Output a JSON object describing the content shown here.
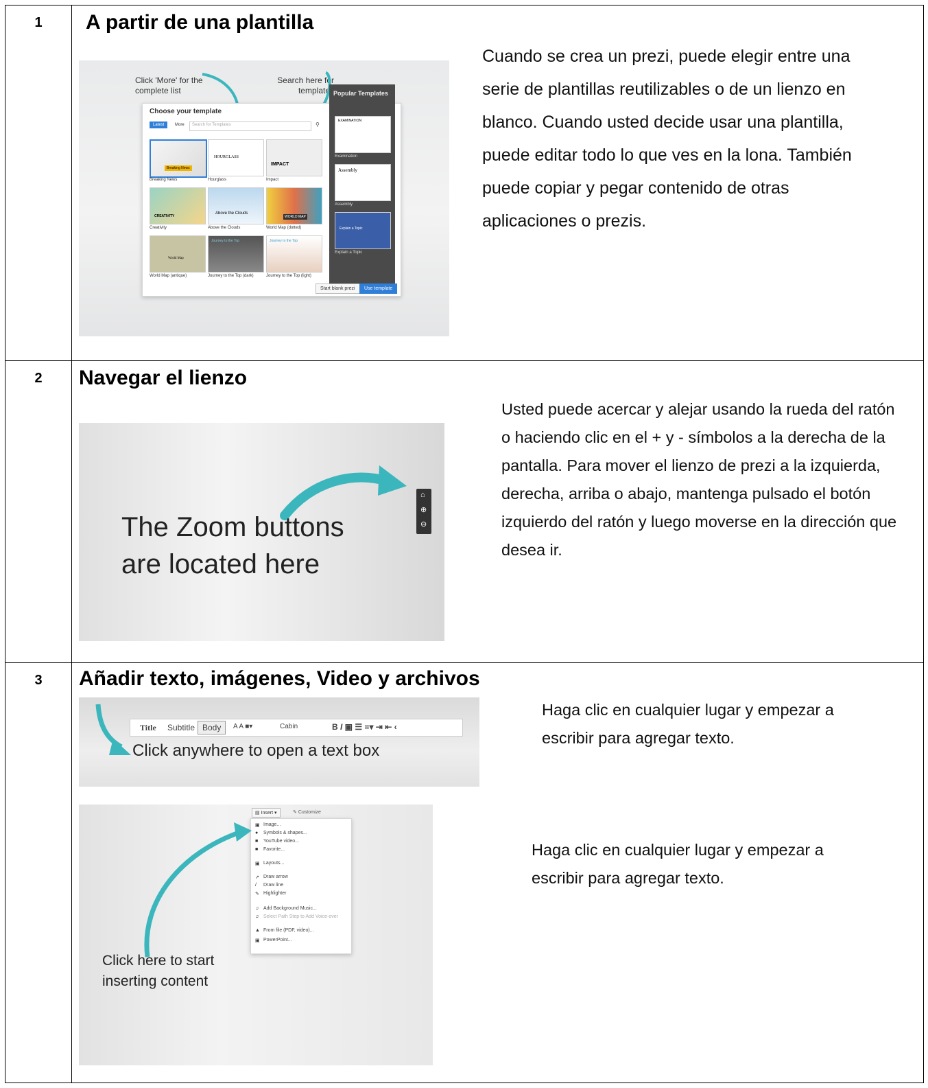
{
  "rows": [
    {
      "number": "1",
      "title": "A partir de una plantilla",
      "paragraph": "Cuando se crea un prezi, puede elegir entre una serie de plantillas reutilizables o de un lienzo en blanco. Cuando usted decide usar una plantilla, puede editar todo lo que ves en la lona. También puede copiar y pegar contenido de otras aplicaciones o prezis.",
      "screenshot": {
        "callout_more": "Click 'More' for the complete list",
        "callout_search": "Search here for templates",
        "dialog_title": "Choose your template",
        "tab_latest": "Latest",
        "tab_more": "More",
        "search_placeholder": "Search for Templates",
        "popular_title": "Popular Templates",
        "templates": [
          "Breaking News",
          "Hourglass",
          "Impact",
          "Creativity",
          "Above the Clouds",
          "World Map (dotted)",
          "World Map (antique)",
          "Journey to the Top (dark)",
          "Journey to the Top (light)"
        ],
        "thumb_texts": [
          "Breaking News",
          "HOURGLASS",
          "IMPACT",
          "CREATIVITY",
          "Above the Clouds",
          "WORLD MAP",
          "World Map",
          "Journey to the Top",
          "Journey to the Top"
        ],
        "popular": [
          "Examination",
          "Assembly",
          "Explain a Topic"
        ],
        "popular_texts": [
          "EXAMINATION",
          "Assembly",
          "Explain a Topic"
        ],
        "btn_blank": "Start blank prezi",
        "btn_use": "Use template"
      }
    },
    {
      "number": "2",
      "title": "Navegar el lienzo",
      "paragraph": "Usted puede acercar y alejar usando la rueda del ratón o haciendo clic en el + y - símbolos a la derecha de la pantalla. Para mover el lienzo de prezi a la izquierda, derecha, arriba o abajo, mantenga pulsado el botón izquierdo del ratón y luego moverse en la dirección que desea ir.",
      "screenshot": {
        "caption_line1": "The Zoom buttons",
        "caption_line2": "are located here"
      }
    },
    {
      "number": "3",
      "title": "Añadir texto, imágenes, Video y archivos",
      "paragraph1": "Haga clic en cualquier lugar y empezar a escribir para agregar texto.",
      "paragraph2": "Haga clic en cualquier lugar y empezar a escribir para agregar texto.",
      "screenshot1": {
        "tb_title": "Title",
        "tb_subtitle": "Subtitle",
        "tb_body": "Body",
        "tb_font": "Cabin",
        "text_box": "Click anywhere to open a text box"
      },
      "screenshot2": {
        "insert_btn": "Insert",
        "customize_btn": "Customize",
        "menu": [
          "Image...",
          "Symbols & shapes...",
          "YouTube video...",
          "Favorite...",
          "Layouts...",
          "Draw arrow",
          "Draw line",
          "Highlighter",
          "Add Background Music...",
          "Select Path Step to Add Voice-over",
          "From file (PDF, video)...",
          "PowerPoint..."
        ],
        "caption_line1": "Click here to start",
        "caption_line2": "inserting content"
      }
    }
  ],
  "colors": {
    "teal": "#3bb6bd",
    "blue_btn": "#2f7fd8",
    "dark_panel": "#4a4a4a"
  }
}
